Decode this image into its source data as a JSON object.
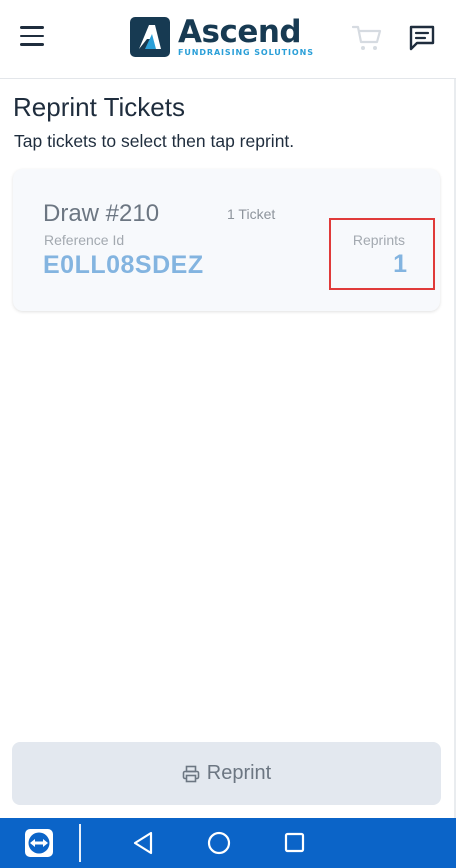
{
  "header": {
    "logo_name": "Ascend",
    "logo_tagline": "FUNDRAISING SOLUTIONS",
    "icons": {
      "menu": "menu-icon",
      "cart": "cart-icon",
      "chat": "chat-icon"
    }
  },
  "page": {
    "title": "Reprint Tickets",
    "subtitle": "Tap tickets to select then tap reprint."
  },
  "tickets": [
    {
      "draw": "Draw #210",
      "count": "1 Ticket",
      "reference_label": "Reference Id",
      "reference_id": "E0LL08SDEZ",
      "reprints_label": "Reprints",
      "reprints": "1"
    }
  ],
  "actions": {
    "reprint_label": "Reprint",
    "reprint_icon": "printer-icon"
  },
  "colors": {
    "brand_dark": "#173a52",
    "brand_accent": "#2a9fd8",
    "reference_blue": "#83b4e0",
    "highlight_red": "#e03a3a",
    "nav_bar": "#0b64c8"
  }
}
